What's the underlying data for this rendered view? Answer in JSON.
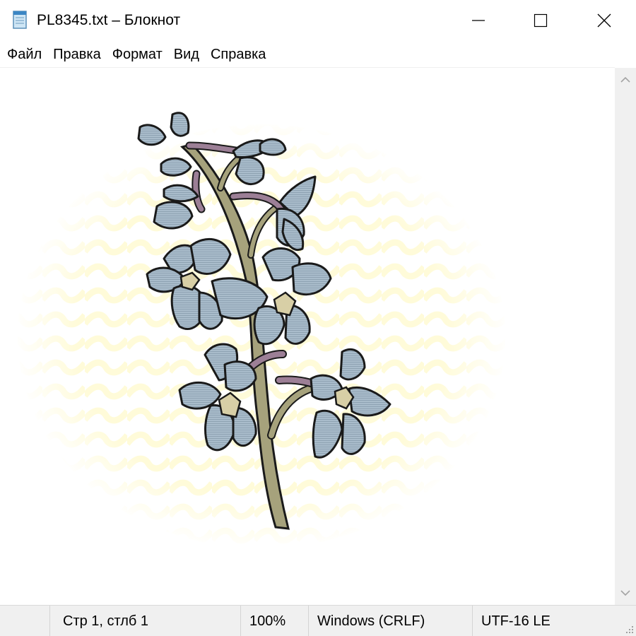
{
  "window": {
    "title": "PL8345.txt – Блокнот",
    "app_icon": "notepad-icon",
    "controls": {
      "minimize": "minimize-icon",
      "maximize": "maximize-icon",
      "close": "close-icon"
    }
  },
  "menu": {
    "items": [
      {
        "label": "Файл"
      },
      {
        "label": "Правка"
      },
      {
        "label": "Формат"
      },
      {
        "label": "Вид"
      },
      {
        "label": "Справка"
      }
    ]
  },
  "editor": {
    "content": "flower-clipart-image",
    "colors": {
      "petal": "#a9bccb",
      "stem": "#a6a27c",
      "branch": "#9c7f96",
      "background_pattern": "#fffbd9",
      "outline": "#1a1a1a"
    }
  },
  "scrollbar": {
    "up": "chevron-up-icon",
    "down": "chevron-down-icon"
  },
  "status": {
    "position": "Стр 1, стлб 1",
    "zoom": "100%",
    "line_endings": "Windows (CRLF)",
    "encoding": "UTF-16 LE"
  }
}
